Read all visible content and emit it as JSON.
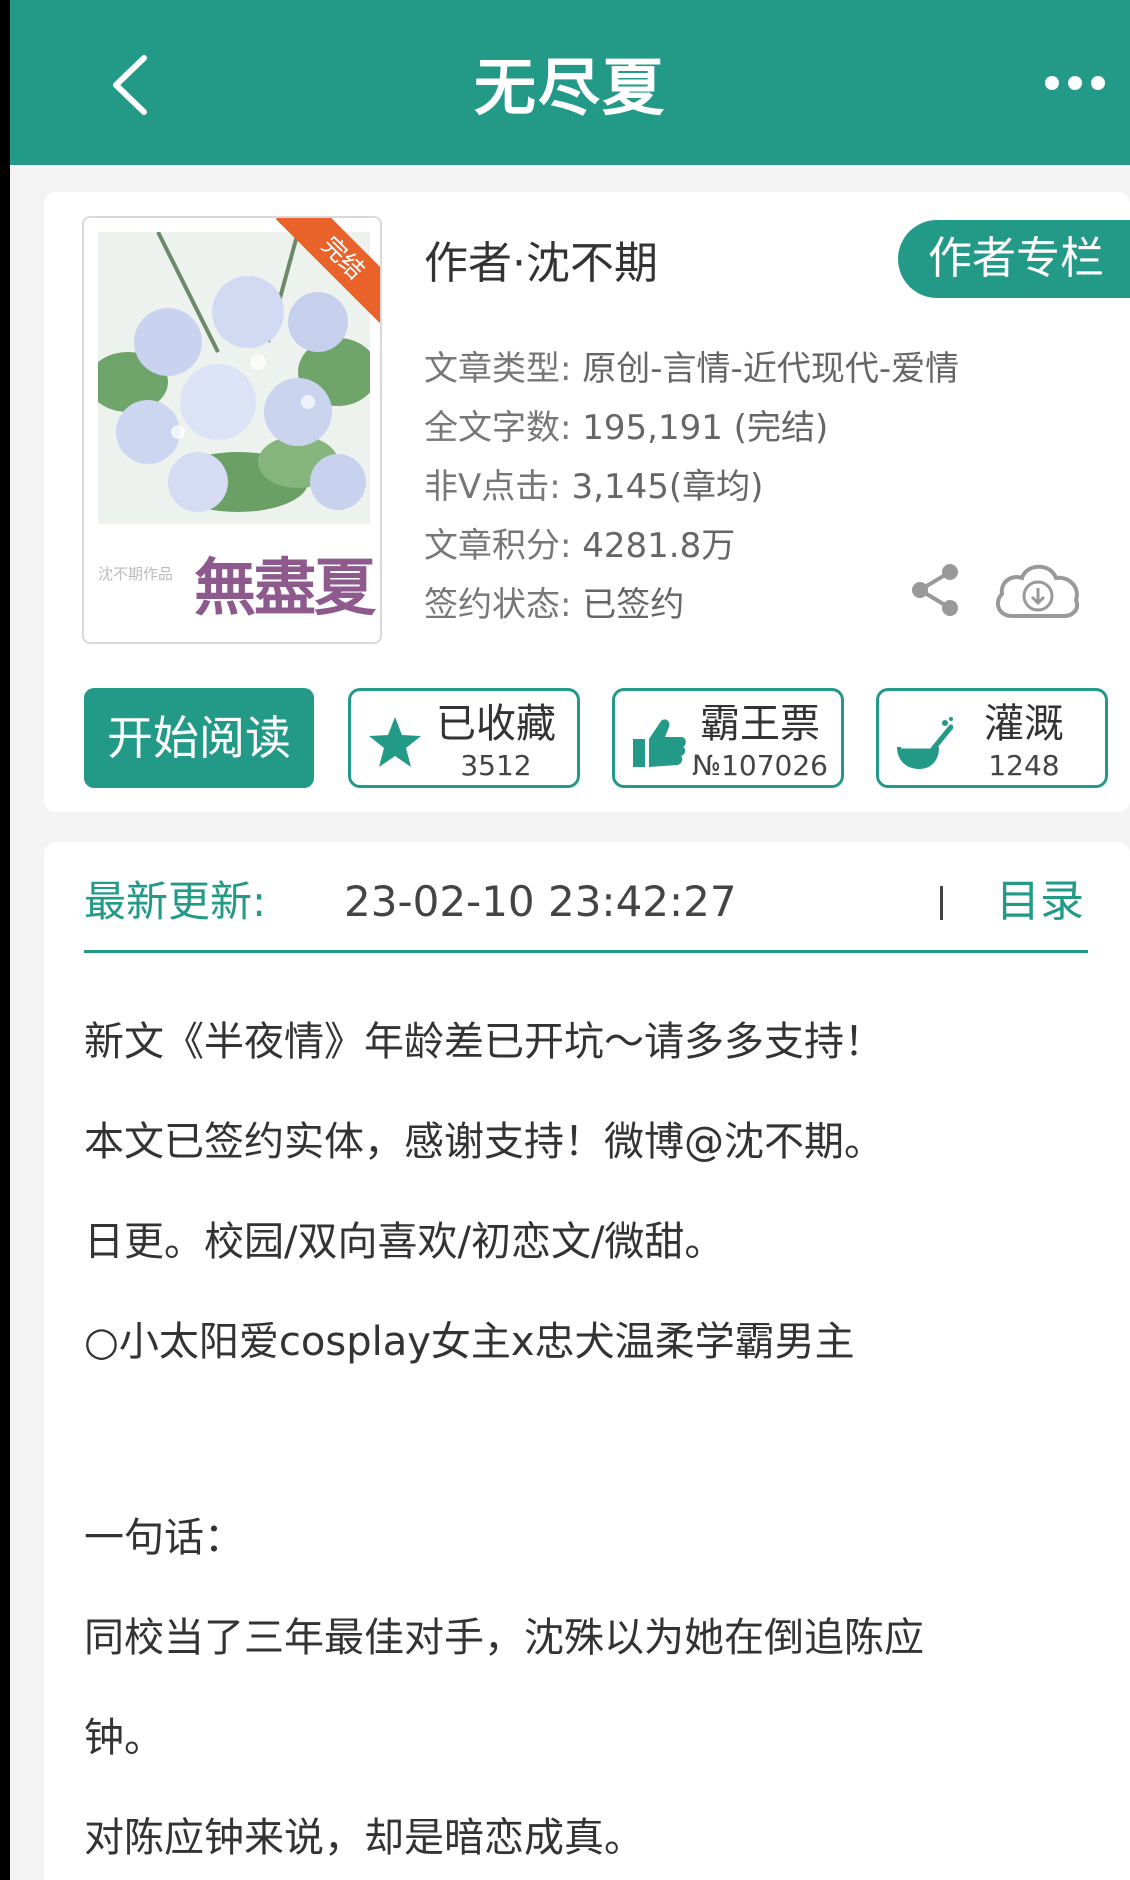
{
  "header": {
    "title": "无尽夏",
    "back_icon": "chevron-left-icon",
    "more_icon": "more-dots-icon"
  },
  "book": {
    "cover": {
      "ribbon": "完结",
      "author_small": "沈不期作品",
      "title_art": "無盡夏"
    },
    "author_line": "作者·沈不期",
    "author_column_button": "作者专栏",
    "meta": [
      {
        "key": "文章类型:",
        "value": " 原创-言情-近代现代-爱情"
      },
      {
        "key": "全文字数:",
        "value": " 195,191 (完结)"
      },
      {
        "key": "非V点击:",
        "value": " 3,145(章均)"
      },
      {
        "key": "文章积分:",
        "value": " 4281.8万"
      },
      {
        "key": "签约状态:",
        "value": " 已签约"
      }
    ],
    "actions": {
      "start_reading": "开始阅读",
      "favorite": {
        "label": "已收藏",
        "count": "3512",
        "icon": "star-icon"
      },
      "overlord_ticket": {
        "label": "霸王票",
        "count": "№107026",
        "icon": "thumbs-up-icon"
      },
      "irrigate": {
        "label": "灌溉",
        "count": "1248",
        "icon": "watering-can-icon"
      }
    }
  },
  "update": {
    "label": "最新更新:",
    "time": "23-02-10 23:42:27",
    "toc": "目录",
    "lines": [
      "新文《半夜情》年龄差已开坑～请多多支持！",
      "本文已签约实体，感谢支持！微博@沈不期。",
      "日更。校园/双向喜欢/初恋文/微甜。",
      "○小太阳爱cosplay女主x忠犬温柔学霸男主",
      "",
      "一句话：",
      "同校当了三年最佳对手，沈殊以为她在倒追陈应",
      "钟。",
      "对陈应钟来说，却是暗恋成真。"
    ]
  },
  "colors": {
    "brand": "#239a87",
    "ribbon": "#e8622a",
    "cover_title": "#8e5a8d"
  }
}
